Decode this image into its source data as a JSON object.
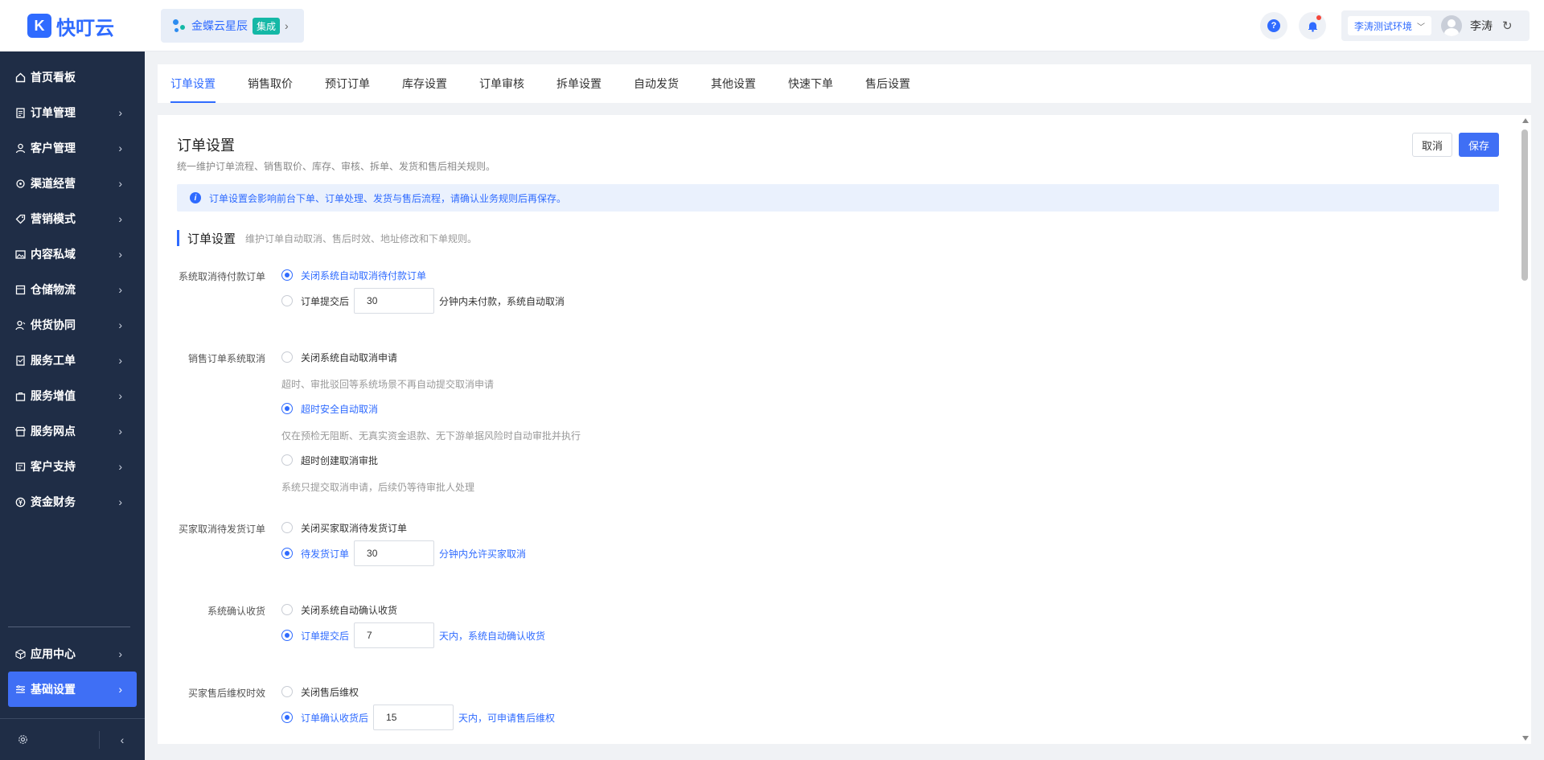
{
  "app": {
    "logo_glyph": "K",
    "logo_text": "快叮云"
  },
  "sidebar": {
    "items": [
      {
        "label": "首页看板",
        "icon": "home-icon",
        "has_chevron": false
      },
      {
        "label": "订单管理",
        "icon": "order-icon"
      },
      {
        "label": "客户管理",
        "icon": "user-icon"
      },
      {
        "label": "渠道经营",
        "icon": "channel-icon"
      },
      {
        "label": "营销模式",
        "icon": "tag-icon"
      },
      {
        "label": "内容私域",
        "icon": "image-icon"
      },
      {
        "label": "仓储物流",
        "icon": "warehouse-icon"
      },
      {
        "label": "供货协同",
        "icon": "supplier-icon"
      },
      {
        "label": "服务工单",
        "icon": "ticket-icon"
      },
      {
        "label": "服务增值",
        "icon": "bag-icon"
      },
      {
        "label": "服务网点",
        "icon": "store-icon"
      },
      {
        "label": "客户支持",
        "icon": "support-icon"
      },
      {
        "label": "资金财务",
        "icon": "yuan-icon"
      }
    ],
    "bottom_items": [
      {
        "label": "应用中心",
        "icon": "cube-icon"
      },
      {
        "label": "基础设置",
        "icon": "settings-list-icon",
        "active": true
      }
    ],
    "footer": {
      "left_icon": "gear-icon",
      "right_icon": "collapse-icon"
    }
  },
  "header": {
    "brand_name": "金蝶云星辰",
    "brand_tag": "集成",
    "env_label": "李涛测试环境",
    "user_name": "李涛",
    "help_glyph": "?",
    "colors": {
      "accent": "#2f6bff",
      "tag": "#14b8a6",
      "notify_dot": "#f5473b"
    }
  },
  "tabs": [
    {
      "label": "订单设置",
      "active": true
    },
    {
      "label": "销售取价"
    },
    {
      "label": "预订订单"
    },
    {
      "label": "库存设置"
    },
    {
      "label": "订单审核"
    },
    {
      "label": "拆单设置"
    },
    {
      "label": "自动发货"
    },
    {
      "label": "其他设置"
    },
    {
      "label": "快速下单"
    },
    {
      "label": "售后设置"
    }
  ],
  "main": {
    "title": "订单设置",
    "description": "统一维护订单流程、销售取价、库存、审核、拆单、发货和售后相关规则。",
    "cancel_label": "取消",
    "save_label": "保存",
    "alert_text": "订单设置会影响前台下单、订单处理、发货与售后流程，请确认业务规则后再保存。",
    "section": {
      "title": "订单设置",
      "subtitle": "维护订单自动取消、售后时效、地址修改和下单规则。"
    },
    "fields": {
      "auto_cancel_unpaid": {
        "label": "系统取消待付款订单",
        "opt1": "关闭系统自动取消待付款订单",
        "opt2_prefix": "订单提交后",
        "opt2_value": "30",
        "opt2_suffix": "分钟内未付款，系统自动取消",
        "selected": 1
      },
      "sales_cancel": {
        "label": "销售订单系统取消",
        "opt1": "关闭系统自动取消申请",
        "opt1_hint": "超时、审批驳回等系统场景不再自动提交取消申请",
        "opt2": "超时安全自动取消",
        "opt2_hint": "仅在预检无阻断、无真实资金退款、无下游单据风险时自动审批并执行",
        "opt3": "超时创建取消审批",
        "opt3_hint": "系统只提交取消申请，后续仍等待审批人处理",
        "selected": 2
      },
      "buyer_cancel": {
        "label": "买家取消待发货订单",
        "opt1": "关闭买家取消待发货订单",
        "opt2_prefix": "待发货订单",
        "opt2_value": "30",
        "opt2_suffix": "分钟内允许买家取消",
        "selected": 2
      },
      "confirm_receipt": {
        "label": "系统确认收货",
        "opt1": "关闭系统自动确认收货",
        "opt2_prefix": "订单提交后",
        "opt2_value": "7",
        "opt2_suffix": "天内，系统自动确认收货",
        "selected": 2
      },
      "after_sale": {
        "label": "买家售后维权时效",
        "opt1": "关闭售后维权",
        "opt2_prefix": "订单确认收货后",
        "opt2_value": "15",
        "opt2_suffix": "天内，可申请售后维权",
        "selected": 2
      }
    }
  }
}
